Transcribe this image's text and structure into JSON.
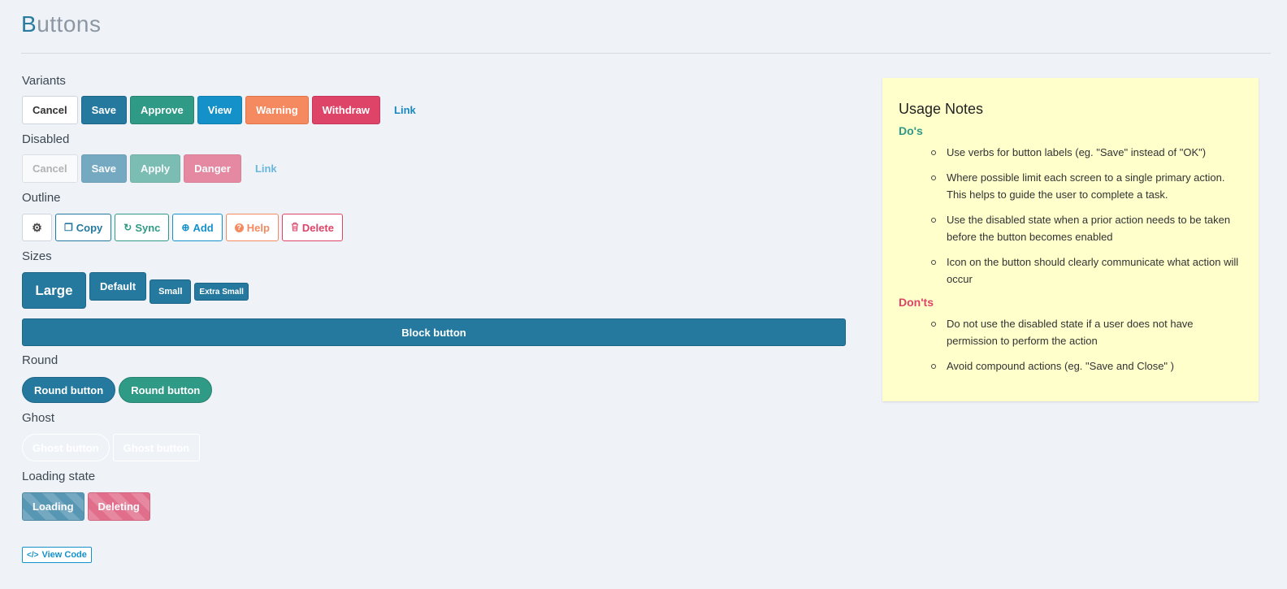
{
  "page": {
    "title_first": "B",
    "title_rest": "uttons"
  },
  "sections": {
    "variants": "Variants",
    "disabled": "Disabled",
    "outline": "Outline",
    "sizes": "Sizes",
    "round": "Round",
    "ghost": "Ghost",
    "loading": "Loading state"
  },
  "variants": {
    "cancel": "Cancel",
    "save": "Save",
    "approve": "Approve",
    "view": "View",
    "warning": "Warning",
    "withdraw": "Withdraw",
    "link": "Link"
  },
  "disabled": {
    "cancel": "Cancel",
    "save": "Save",
    "apply": "Apply",
    "danger": "Danger",
    "link": "Link"
  },
  "outline": {
    "settings_icon": "gear-icon",
    "copy": "Copy",
    "copy_icon": "copy-icon",
    "sync": "Sync",
    "sync_icon": "refresh-icon",
    "add": "Add",
    "add_icon": "plus-circle-icon",
    "help": "Help",
    "help_icon": "question-circle-icon",
    "delete": "Delete",
    "delete_icon": "trash-icon"
  },
  "sizes": {
    "large": "Large",
    "default": "Default",
    "small": "Small",
    "extra_small": "Extra Small",
    "block": "Block button"
  },
  "round": {
    "primary": "Round button",
    "success": "Round button"
  },
  "ghost": {
    "round": "Ghost button",
    "square": "Ghost button"
  },
  "loading": {
    "loading": "Loading",
    "deleting": "Deleting"
  },
  "view_code": {
    "label": "View Code",
    "icon": "code-icon"
  },
  "notes": {
    "title": "Usage Notes",
    "dos_title": "Do's",
    "dos": [
      "Use verbs for button labels (eg. \"Save\" instead of \"OK\")",
      "Where possible limit each screen to a single primary action. This helps to guide the user to complete a task.",
      "Use the disabled state when a prior action needs to be taken before the button becomes enabled",
      "Icon on the button should clearly communicate what action will occur"
    ],
    "donts_title": "Don'ts",
    "donts": [
      "Do not use the disabled state if a user does not have permission to perform the action",
      "Avoid compound actions (eg. \"Save and Close\" )"
    ]
  },
  "colors": {
    "primary": "#25799e",
    "success": "#2f9a86",
    "info": "#1591c9",
    "warning": "#f58a61",
    "danger": "#dd4468",
    "background": "#eff3f8",
    "notes_background": "#ffffcc"
  }
}
